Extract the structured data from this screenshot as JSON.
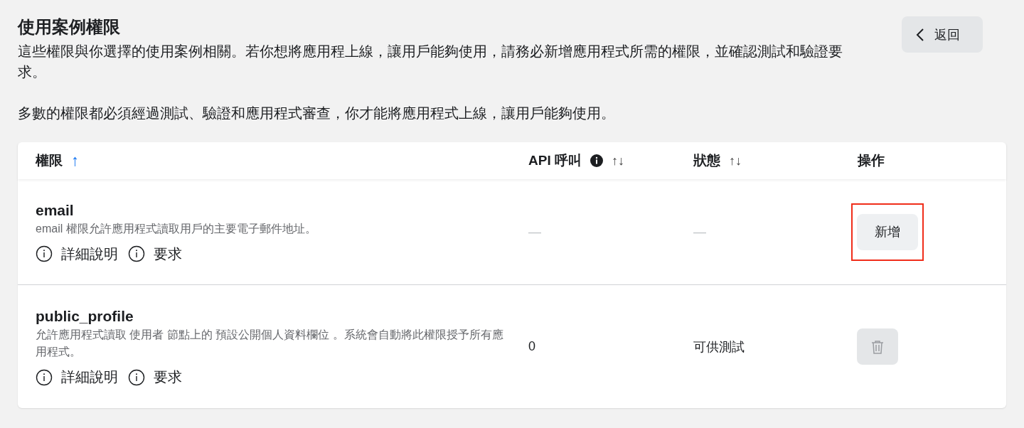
{
  "header": {
    "title": "使用案例權限",
    "description": "這些權限與你選擇的使用案例相關。若你想將應用程上線，讓用戶能夠使用，請務必新增應用程式所需的權限，並確認測試和驗證要求。",
    "note": "多數的權限都必須經過測試、驗證和應用程式審查，你才能將應用程式上線，讓用戶能夠使用。",
    "back_button": "返回"
  },
  "table": {
    "columns": [
      {
        "label": "權限",
        "sort": "↑",
        "sorted": true
      },
      {
        "label": "API 呼叫",
        "sort": "↑↓",
        "sorted": false,
        "info": true
      },
      {
        "label": "狀態",
        "sort": "↑↓",
        "sorted": false
      },
      {
        "label": "操作"
      }
    ],
    "rows": [
      {
        "name": "email",
        "description": "email 權限允許應用程式讀取用戶的主要電子郵件地址。",
        "links": [
          "詳細說明",
          "要求"
        ],
        "api_calls": "—",
        "api_calls_empty": true,
        "status": "—",
        "status_empty": true,
        "action": {
          "kind": "add",
          "label": "新增",
          "highlighted": true,
          "disabled": false
        }
      },
      {
        "name": "public_profile",
        "description": "允許應用程式讀取 使用者 節點上的 預設公開個人資料欄位 。系統會自動將此權限授予所有應用程式。",
        "links": [
          "詳細說明",
          "要求"
        ],
        "api_calls": "0",
        "api_calls_empty": false,
        "status": "可供測試",
        "status_empty": false,
        "action": {
          "kind": "delete",
          "disabled": true
        }
      }
    ]
  }
}
